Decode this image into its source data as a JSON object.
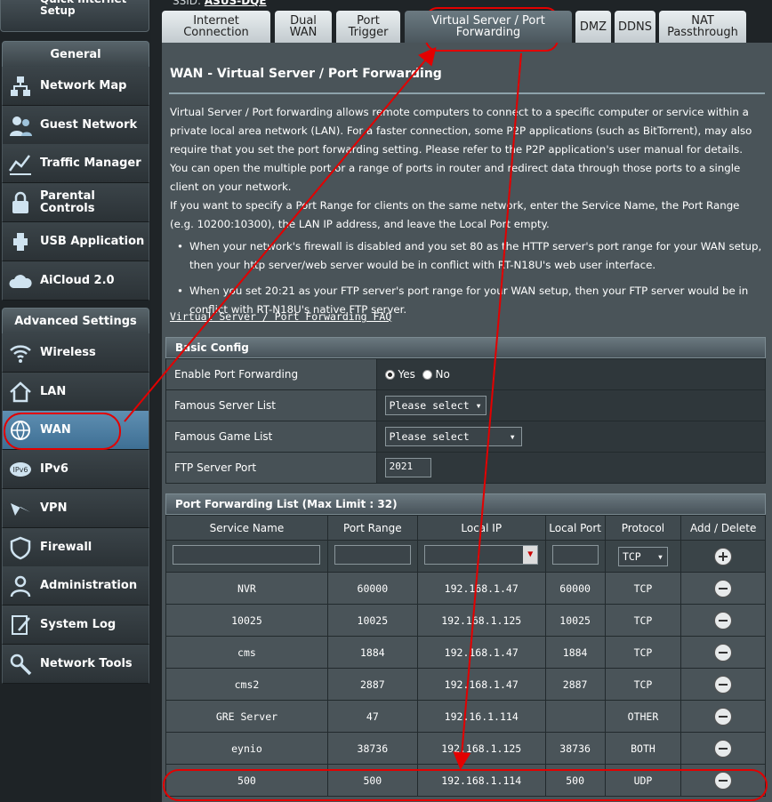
{
  "quick_setup": "Quick Internet Setup",
  "general_header": "General",
  "general_items": [
    {
      "label": "Network Map",
      "icon": "network-map-icon"
    },
    {
      "label": "Guest Network",
      "icon": "guest-network-icon"
    },
    {
      "label": "Traffic Manager",
      "icon": "traffic-manager-icon"
    },
    {
      "label": "Parental Controls",
      "icon": "parental-controls-icon"
    },
    {
      "label": "USB Application",
      "icon": "usb-icon"
    },
    {
      "label": "AiCloud 2.0",
      "icon": "cloud-icon"
    }
  ],
  "advanced_header": "Advanced Settings",
  "advanced_items": [
    {
      "label": "Wireless",
      "icon": "wireless-icon"
    },
    {
      "label": "LAN",
      "icon": "home-icon"
    },
    {
      "label": "WAN",
      "icon": "globe-icon"
    },
    {
      "label": "IPv6",
      "icon": "ipv6-icon"
    },
    {
      "label": "VPN",
      "icon": "vpn-icon"
    },
    {
      "label": "Firewall",
      "icon": "shield-icon"
    },
    {
      "label": "Administration",
      "icon": "user-icon"
    },
    {
      "label": "System Log",
      "icon": "log-icon"
    },
    {
      "label": "Network Tools",
      "icon": "tools-icon"
    }
  ],
  "ssid_label": "SSID:",
  "ssid_value": "ASUS-DQE",
  "tabs": [
    "Internet Connection",
    "Dual WAN",
    "Port Trigger",
    "Virtual Server / Port Forwarding",
    "DMZ",
    "DDNS",
    "NAT Passthrough"
  ],
  "page_title": "WAN - Virtual Server / Port Forwarding",
  "desc_p1": "Virtual Server / Port forwarding allows remote computers to connect to a specific computer or service within a private local area network (LAN). For a faster connection, some P2P applications (such as BitTorrent), may also require that you set the port forwarding setting. Please refer to the P2P application's user manual for details. You can open the multiple port or a range of ports in router and redirect data through those ports to a single client on your network.",
  "desc_p2": "If you want to specify a Port Range for clients on the same network, enter the Service Name, the Port Range (e.g. 10200:10300), the LAN IP address, and leave the Local Port empty.",
  "bullet1": "When your network's firewall is disabled and you set 80 as the HTTP server's port range for your WAN setup, then your http server/web server would be in conflict with RT-N18U's web user interface.",
  "bullet2": "When you set 20:21 as your FTP server's port range for your WAN setup, then your FTP server would be in conflict with RT-N18U's native FTP server.",
  "faq": "Virtual Server / Port Forwarding FAQ",
  "basic_config": "Basic Config",
  "enable_pf": "Enable Port Forwarding",
  "yes": "Yes",
  "no": "No",
  "famous_server": "Famous Server List",
  "famous_game": "Famous Game List",
  "please_select": "Please select",
  "ftp_port_label": "FTP Server Port",
  "ftp_port": "2021",
  "pf_header": "Port Forwarding List (Max Limit : 32)",
  "cols": [
    "Service Name",
    "Port Range",
    "Local IP",
    "Local Port",
    "Protocol",
    "Add / Delete"
  ],
  "proto_default": "TCP",
  "rows": [
    [
      "NVR",
      "60000",
      "192.168.1.47",
      "60000",
      "TCP"
    ],
    [
      "10025",
      "10025",
      "192.168.1.125",
      "10025",
      "TCP"
    ],
    [
      "cms",
      "1884",
      "192.168.1.47",
      "1884",
      "TCP"
    ],
    [
      "cms2",
      "2887",
      "192.168.1.47",
      "2887",
      "TCP"
    ],
    [
      "GRE Server",
      "47",
      "192.16.1.114",
      "",
      "OTHER"
    ],
    [
      "eynio",
      "38736",
      "192.168.1.125",
      "38736",
      "BOTH"
    ],
    [
      "500",
      "500",
      "192.168.1.114",
      "500",
      "UDP"
    ]
  ]
}
